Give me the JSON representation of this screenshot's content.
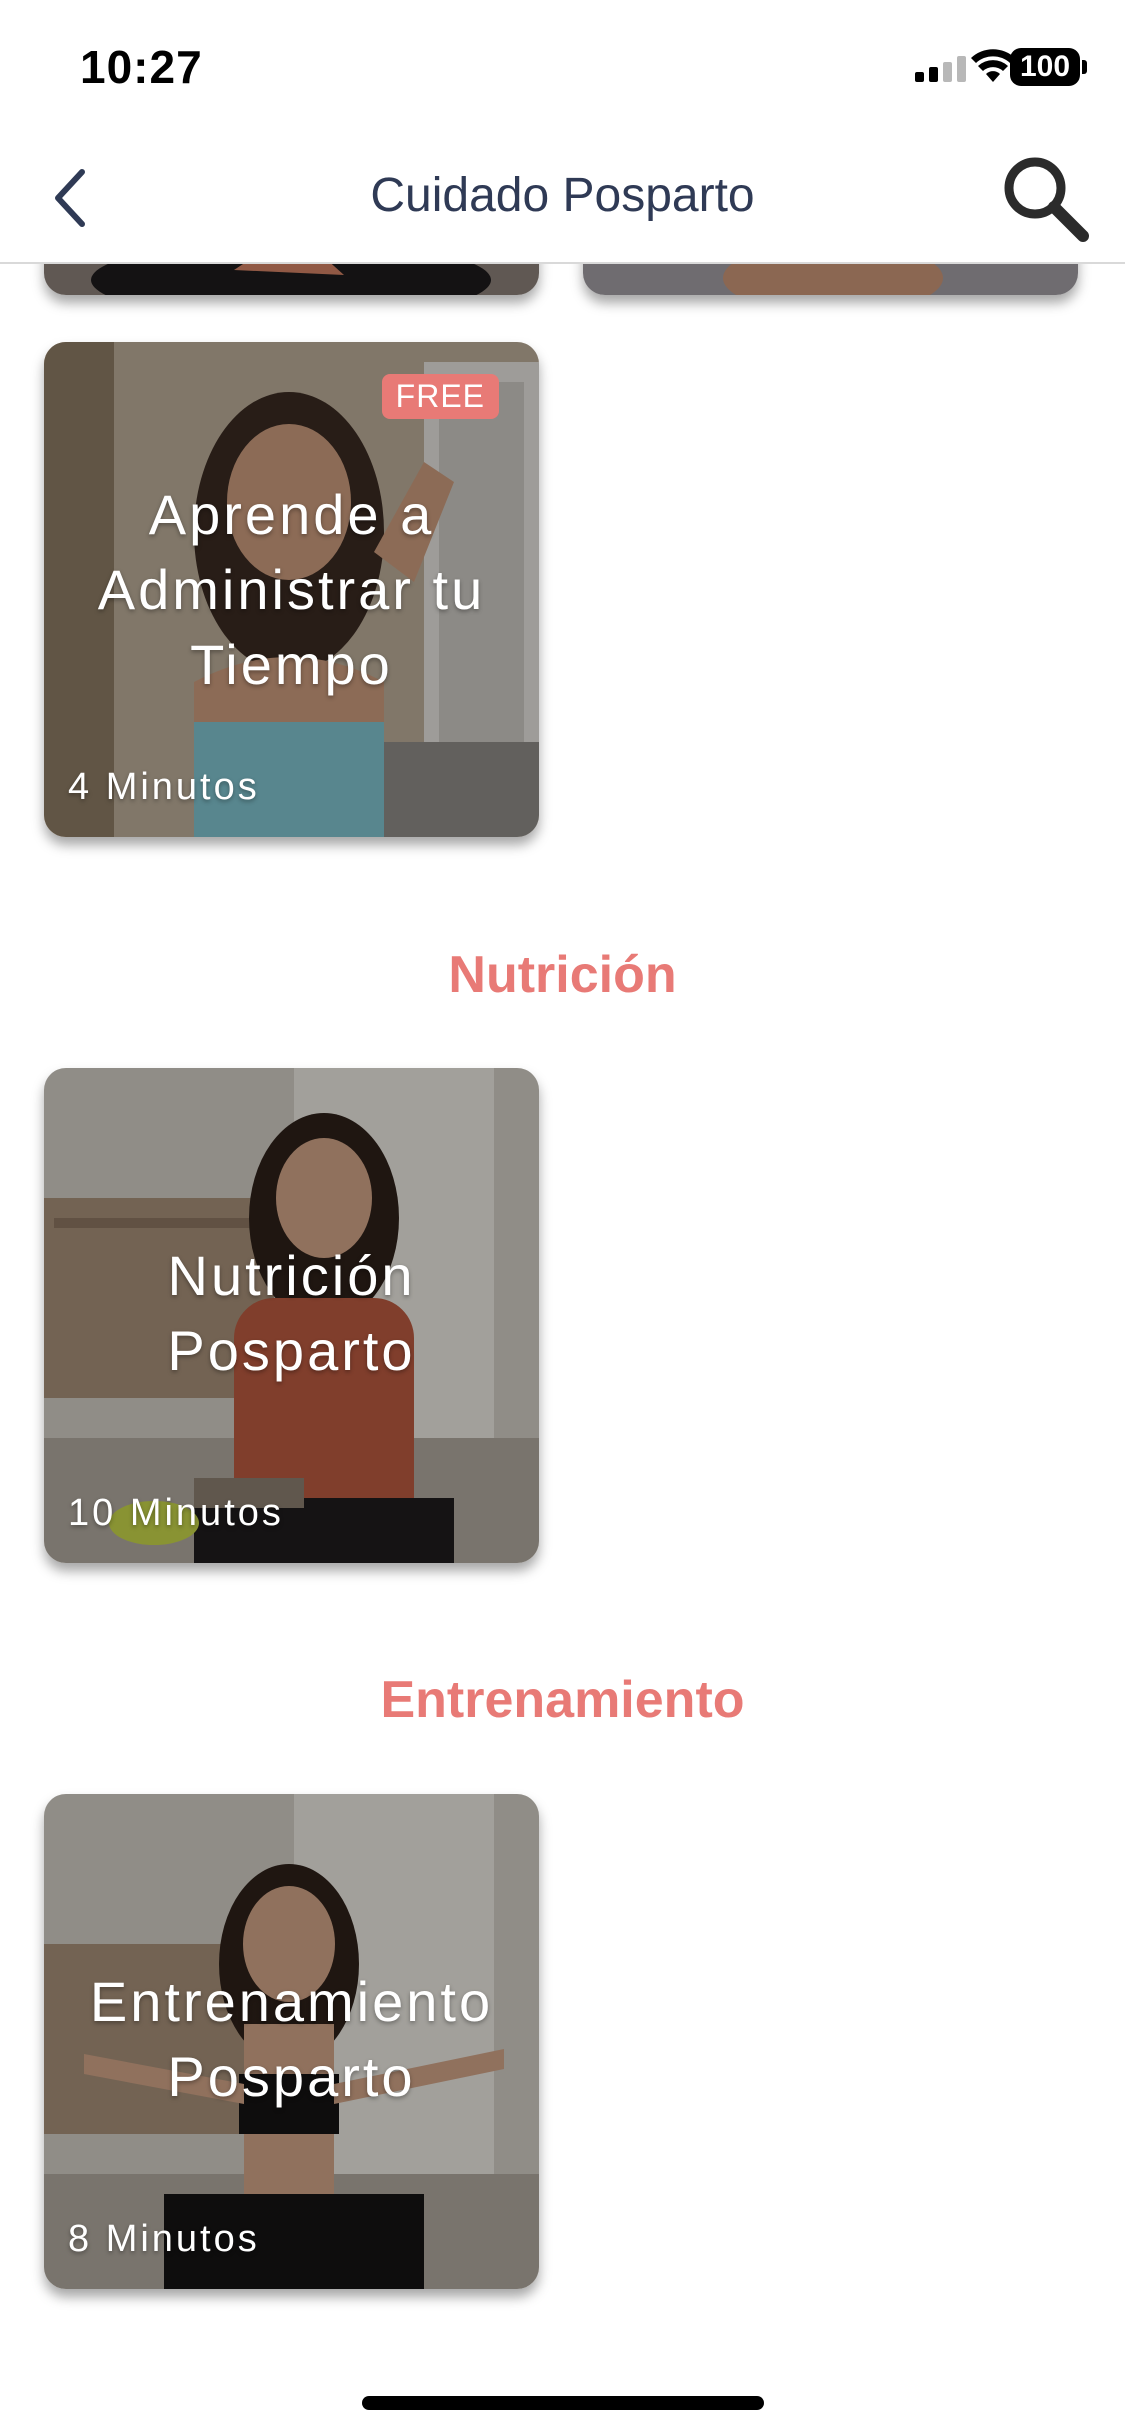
{
  "status_bar": {
    "time": "10:27",
    "battery": "100"
  },
  "nav": {
    "title": "Cuidado Posparto"
  },
  "sections": [
    {
      "title": "",
      "cards": [
        {
          "title": "Aprende a Administrar tu Tiempo",
          "duration": "4 Minutos",
          "badge": "FREE"
        }
      ]
    },
    {
      "title": "Nutrición",
      "cards": [
        {
          "title": "Nutrición Posparto",
          "duration": "10 Minutos"
        }
      ]
    },
    {
      "title": "Entrenamiento",
      "cards": [
        {
          "title": "Entrenamiento Posparto",
          "duration": "8 Minutos"
        }
      ]
    }
  ],
  "colors": {
    "accent": "#e87a76",
    "nav_title": "#2f3a55"
  }
}
